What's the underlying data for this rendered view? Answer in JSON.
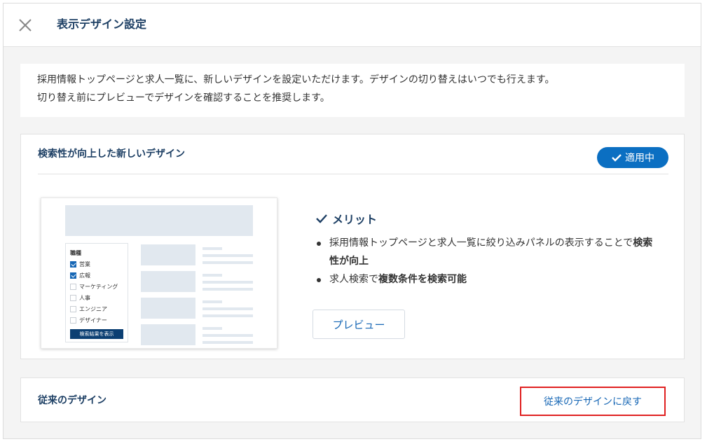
{
  "header": {
    "title": "表示デザイン設定",
    "close_icon": "close-icon"
  },
  "intro": {
    "line1": "採用情報トップページと求人一覧に、新しいデザインを設定いただけます。デザインの切り替えはいつでも行えます。",
    "line2": "切り替え前にプレビューでデザインを確認することを推奨します。"
  },
  "new_design": {
    "title": "検索性が向上した新しいデザイン",
    "badge_label": "適用中",
    "badge_icon": "check-icon",
    "accent_color": "#0b6fc2",
    "merit": {
      "heading": "メリット",
      "heading_icon": "check-icon",
      "items": [
        {
          "text": "採用情報トップページと求人一覧に絞り込みパネルの表示することで",
          "bold": "検索性が向上",
          "suffix": ""
        },
        {
          "text": "求人検索で",
          "bold": "複数条件を検索可能",
          "suffix": ""
        }
      ]
    },
    "preview_label": "プレビュー",
    "thumbnail": {
      "panel_title": "職種",
      "options": [
        {
          "label": "営業",
          "checked": true
        },
        {
          "label": "広報",
          "checked": true
        },
        {
          "label": "マーケティング",
          "checked": false
        },
        {
          "label": "人事",
          "checked": false
        },
        {
          "label": "エンジニア",
          "checked": false
        },
        {
          "label": "デザイナー",
          "checked": false
        }
      ],
      "button_label": "検索結果を表示"
    }
  },
  "old_design": {
    "title": "従来のデザイン",
    "revert_label": "従来のデザインに戻す",
    "highlight_color": "#e02020"
  }
}
